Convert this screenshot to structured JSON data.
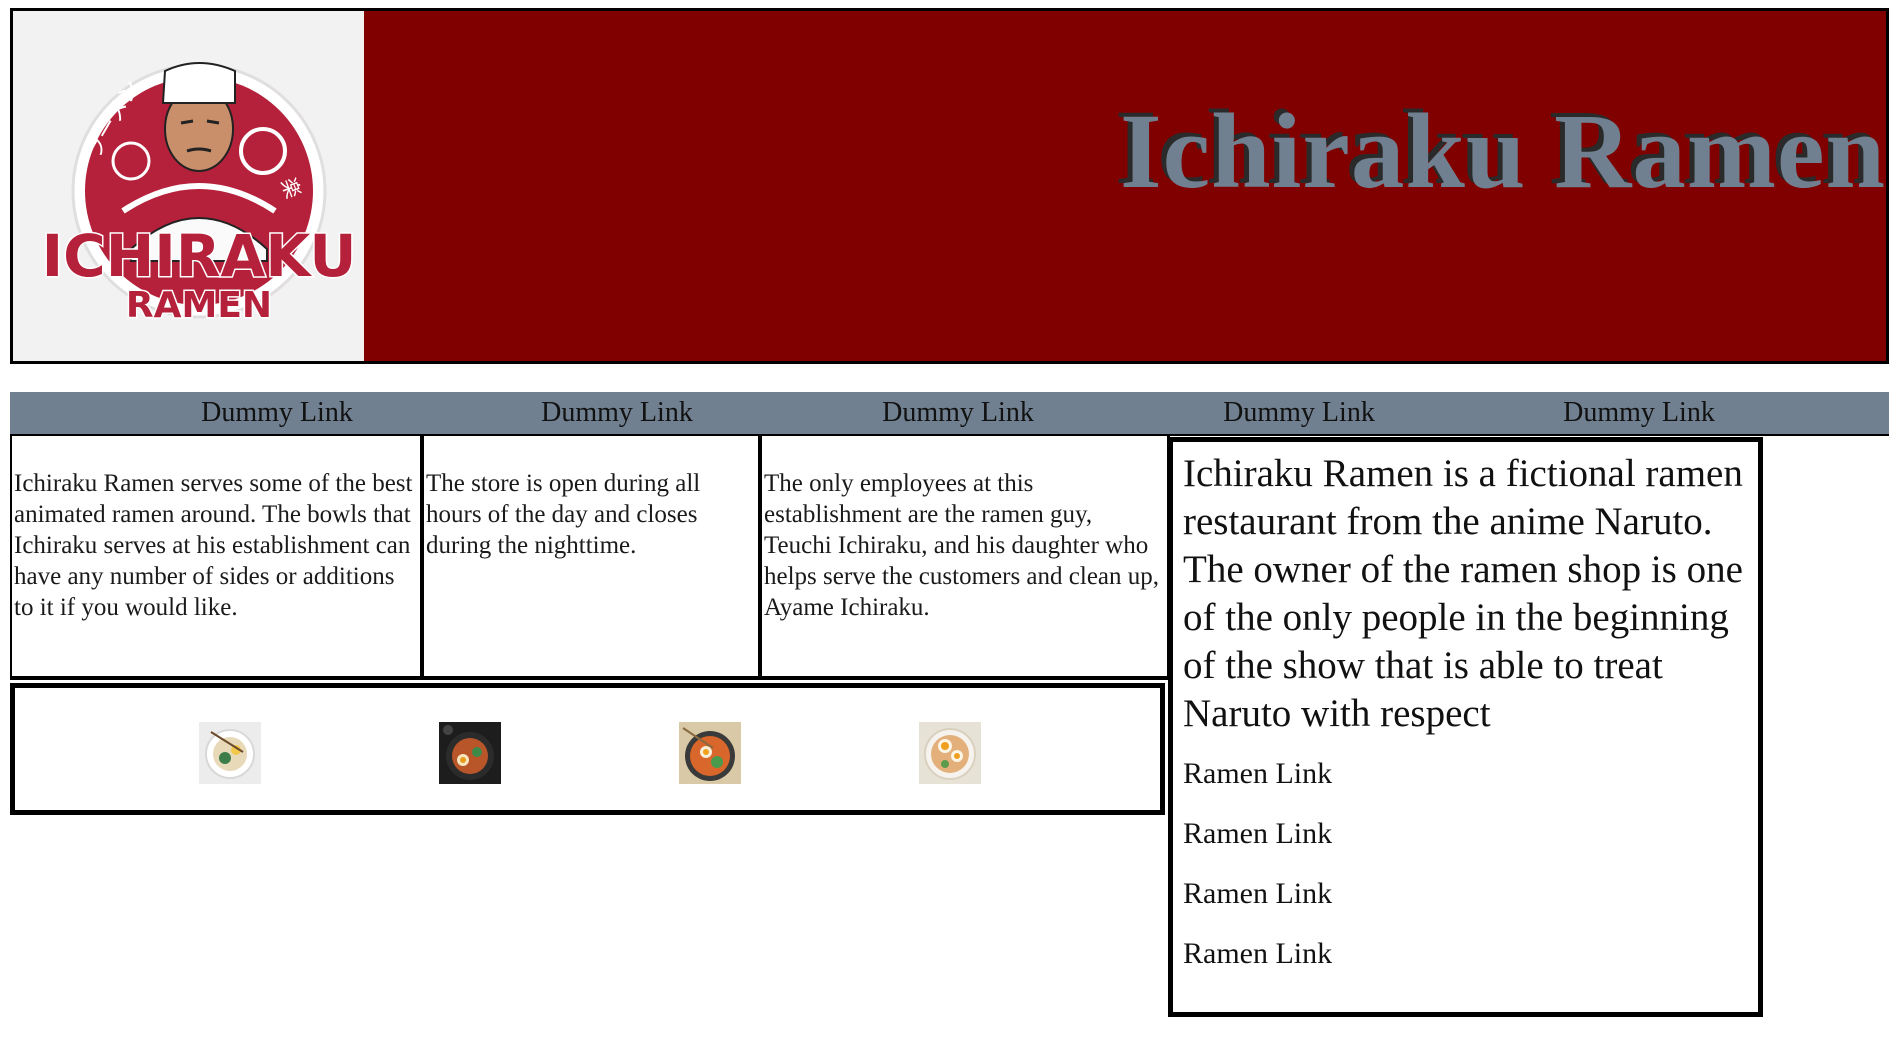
{
  "header": {
    "title": "Ichiraku Ramen",
    "logo_alt": "ICHIRAKU RAMEN",
    "logo_text_top": "ICHIRAKU",
    "logo_text_bottom": "RAMEN"
  },
  "nav": {
    "links": [
      {
        "label": "Dummy Link"
      },
      {
        "label": "Dummy Link"
      },
      {
        "label": "Dummy Link"
      },
      {
        "label": "Dummy Link"
      },
      {
        "label": "Dummy Link"
      }
    ]
  },
  "columns": [
    {
      "text": "Ichiraku Ramen serves some of the best animated ramen around. The bowls that Ichiraku serves at his establishment can have any number of sides or additions to it if you would like."
    },
    {
      "text": "The store is open during all hours of the day and closes during the nighttime."
    },
    {
      "text": "The only employees at this establishment are the ramen guy, Teuchi Ichiraku, and his daughter who helps serve the customers and clean up, Ayame Ichiraku."
    }
  ],
  "gallery": {
    "images": [
      {
        "icon": "ramen-bowl-white-icon"
      },
      {
        "icon": "ramen-bowl-dark-icon"
      },
      {
        "icon": "ramen-bowl-orange-icon"
      },
      {
        "icon": "ramen-bowl-egg-icon"
      }
    ]
  },
  "aside": {
    "text": "Ichiraku Ramen is a fictional ramen restaurant from the anime Naruto. The owner of the ramen shop is one of the only people in the beginning of the show that is able to treat Naruto with respect",
    "links": [
      {
        "label": "Ramen Link"
      },
      {
        "label": "Ramen Link"
      },
      {
        "label": "Ramen Link"
      },
      {
        "label": "Ramen Link"
      }
    ]
  },
  "colors": {
    "header_bg": "#800000",
    "nav_bg": "#708090",
    "title_color": "#708090",
    "logo_red": "#b5213a"
  }
}
